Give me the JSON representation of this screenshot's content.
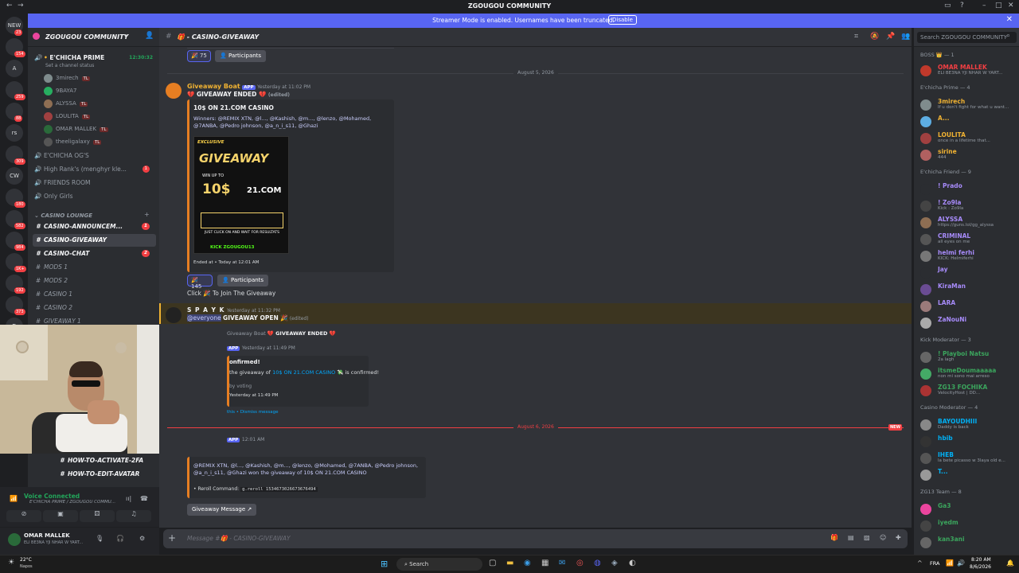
{
  "window": {
    "title": "ZGOUGOU COMMUNITY"
  },
  "streamer": {
    "text": "Streamer Mode is enabled. Usernames have been truncated.",
    "disable": "Disable"
  },
  "guilds": [
    {
      "label": "NEW",
      "badge": "23"
    },
    {
      "label": "",
      "badge": "154"
    },
    {
      "label": "A",
      "badge": ""
    },
    {
      "label": "",
      "badge": "259"
    },
    {
      "label": "",
      "badge": "88"
    },
    {
      "label": "rs",
      "badge": ""
    },
    {
      "label": "",
      "badge": "309"
    },
    {
      "label": "CW",
      "badge": ""
    },
    {
      "label": "",
      "badge": "180"
    },
    {
      "label": "",
      "badge": "582"
    },
    {
      "label": "",
      "badge": "984"
    },
    {
      "label": "",
      "badge": "1K+"
    },
    {
      "label": "",
      "badge": "192"
    },
    {
      "label": "",
      "badge": "373"
    },
    {
      "label": "D",
      "badge": ""
    }
  ],
  "server": {
    "name": "ZGOUGOU COMMUNITY"
  },
  "voice_channel": {
    "name": "E'CHICHA PRIME",
    "time": "12:30:32",
    "status": "Set a channel status",
    "users": [
      "3mirech",
      "9BAYA7",
      "ALYSSA",
      "LOULITA",
      "OMAR MALLEK",
      "theeligalaxy"
    ],
    "tag": "TL"
  },
  "channels": [
    {
      "icon": "🔊",
      "name": "E'CHICHA OG'S",
      "badge": ""
    },
    {
      "icon": "🔊",
      "name": "High Rank's (menghyr kle...",
      "badge": "1"
    },
    {
      "icon": "🔊",
      "name": "FRIENDS ROOM",
      "badge": ""
    },
    {
      "icon": "🔊",
      "name": "Only Girls",
      "badge": ""
    }
  ],
  "category": "CASINO LOUNGE",
  "casino_channels": [
    {
      "name": "CASINO-ANNOUNCEM...",
      "badge": "1",
      "sel": false,
      "bold": true
    },
    {
      "name": "CASINO-GIVEAWAY",
      "badge": "",
      "sel": true,
      "bold": true
    },
    {
      "name": "CASINO-CHAT",
      "badge": "2",
      "sel": false,
      "bold": true
    },
    {
      "name": "MODS 1",
      "badge": "",
      "sel": false,
      "bold": false
    },
    {
      "name": "MODS 2",
      "badge": "",
      "sel": false,
      "bold": false
    },
    {
      "name": "CASINO 1",
      "badge": "",
      "sel": false,
      "bold": false
    },
    {
      "name": "CASINO 2",
      "badge": "",
      "sel": false,
      "bold": false
    },
    {
      "name": "GIVEAWAY 1",
      "badge": "",
      "sel": false,
      "bold": false
    }
  ],
  "lower_channels": [
    "HOW-TO-ACTIVATE-2FA",
    "HOW-TO-EDIT-AVATAR"
  ],
  "voice_connected": {
    "label": "Voice Connected",
    "sub": "E'CHICHA PRIME / ZGOUGOU COMMU..."
  },
  "user": {
    "name": "OMAR MALLEK",
    "status": "ELI BE3NA YJI NHAR W YART..."
  },
  "channel_header": {
    "name": "CASINO-GIVEAWAY",
    "search": "Search ZGOUGOU COMMUNITY"
  },
  "messages": {
    "top_reaction": "75",
    "participants": "Participants",
    "date1": "August 5, 2026",
    "bot_name": "Giveaway Boat",
    "app": "APP",
    "bot_ts": "Yesterday at 11:02 PM",
    "ended": "GIVEAWAY ENDED",
    "edited": "(edited)",
    "prize": "10$ ON 21.COM CASINO",
    "winners": "Winners: @REMIX XTN, @l..., @Kashish, @m..., @lenzo, @Mohamed, @7ANBA, @Pedro johnson, @a_n_i_s11, @Ghazi",
    "poster": {
      "exclusive": "EXCLUSIVE",
      "giveaway": "GIVEAWAY",
      "win": "WIN UP TO",
      "amount": "10$",
      "site": "21.COM",
      "join": "JUST CLICK ON AND WAIT FOR RESULTATS",
      "kick": "KICK ZGOUGOU13"
    },
    "ended_at": "Ended at • Today at 12:01 AM",
    "reaction2": "145",
    "click": "Click",
    "click2": "To Join The Giveaway",
    "spayk": "S P A Y K",
    "spayk_ts": "Yesterday at 11:32 PM",
    "everyone": "@everyone",
    "gopen": "GIVEAWAY OPEN",
    "reply_name": "Giveaway Boat",
    "reply_text": "GIVEAWAY ENDED",
    "conf_title": "onfirmed!",
    "conf_text1": "the giveaway of",
    "conf_link": "10$ ON 21.COM CASINO",
    "conf_text2": "is confirmed!",
    "voting": "by voting",
    "conf_ts": "Yesterday at 11:49 PM",
    "dismiss": "this • Dismiss message",
    "date2": "August 6, 2026",
    "new": "NEW",
    "bot2_ts": "12:01 AM",
    "win_text": "@REMIX XTN, @l..., @Kashish, @m..., @lenzo, @Mohamed, @7ANBA, @Pedro johnson, @a_n_i_s11, @Ghazi won the giveaway of 10$ ON 21.COM CASINO",
    "reroll_label": "• Reroll Command:",
    "reroll_cmd": "g.reroll 1534673026673676494",
    "gmessage": "Giveaway Message"
  },
  "input": {
    "placeholder": "Message #🎁 - CASINO-GIVEAWAY"
  },
  "members": [
    {
      "head": "BOSS 👑 — 1",
      "y": 0
    },
    {
      "name": "OMAR MALLEK",
      "status": "ELI BE3NA YJI NHAR W YART...",
      "color": "#f23f43",
      "y": 1,
      "av": "#c0392b"
    },
    {
      "head": "E'chicha Prime — 4",
      "y": 2
    },
    {
      "name": "3mirech",
      "status": "If u don't fight for what u want...",
      "color": "#f0b232",
      "y": 3,
      "av": "#7f8c8d"
    },
    {
      "name": "A...",
      "status": "",
      "color": "#f0b232",
      "y": 4,
      "av": "#5dade2"
    },
    {
      "name": "LOULITA",
      "status": "once in a lifetime that...",
      "color": "#f0b232",
      "y": 5,
      "av": "#a04040"
    },
    {
      "name": "sirine",
      "status": "444",
      "color": "#f0b232",
      "y": 6,
      "av": "#b06060"
    },
    {
      "head": "E'chicha Friend — 9",
      "y": 7
    },
    {
      "name": "! Prado",
      "status": "",
      "color": "#a78bfa",
      "y": 8,
      "av": "#2b2d31"
    },
    {
      "name": "! Zo9la",
      "status": "Kick : Zo9la",
      "color": "#a78bfa",
      "y": 9,
      "av": "#444"
    },
    {
      "name": "ALYSSA",
      "status": "https://guns.lol/gg_alyssa",
      "color": "#a78bfa",
      "y": 10,
      "av": "#8e6e53"
    },
    {
      "name": "CRIMINAL",
      "status": "all eyes on me",
      "color": "#a78bfa",
      "y": 11,
      "av": "#555"
    },
    {
      "name": "helmi ferhi",
      "status": "KICK: Helmiferhi",
      "color": "#a78bfa",
      "y": 12,
      "av": "#777"
    },
    {
      "name": "Jay",
      "status": "",
      "color": "#a78bfa",
      "y": 13,
      "av": "#2b2d31"
    },
    {
      "name": "KiraMan",
      "status": "",
      "color": "#a78bfa",
      "y": 14,
      "av": "#6a4c93"
    },
    {
      "name": "LARA",
      "status": "",
      "color": "#a78bfa",
      "y": 15,
      "av": "#9b7a7a"
    },
    {
      "name": "ZaNouNi",
      "status": "",
      "color": "#a78bfa",
      "y": 16,
      "av": "#aaa"
    },
    {
      "head": "Kick Moderator — 3",
      "y": 17
    },
    {
      "name": "! Playboi Natsu",
      "status": "2a lagh",
      "color": "#3ba55d",
      "y": 18,
      "av": "#666"
    },
    {
      "name": "itsmeDoumaaaaa",
      "status": "non mi sono mai arreso",
      "color": "#3ba55d",
      "y": 19,
      "av": "#4a6"
    },
    {
      "name": "ZG13 FOCHIKA",
      "status": "VelocityHost | DD...",
      "color": "#3ba55d",
      "y": 20,
      "av": "#a33"
    },
    {
      "head": "Casino Moderator — 4",
      "y": 21
    },
    {
      "name": "BAYOUDHIII",
      "status": "Daddy is back",
      "color": "#00b0f4",
      "y": 22,
      "av": "#888"
    },
    {
      "name": "hbib",
      "status": "",
      "color": "#00b0f4",
      "y": 23,
      "av": "#333"
    },
    {
      "name": "IHEB",
      "status": "la bete picasso w 3laya old e...",
      "color": "#00b0f4",
      "y": 24,
      "av": "#555"
    },
    {
      "name": "T...",
      "status": "",
      "color": "#00b0f4",
      "y": 25,
      "av": "#999"
    },
    {
      "head": "ZG13 Team — 8",
      "y": 26
    },
    {
      "name": "Ga3",
      "status": "",
      "color": "#3ba55d",
      "y": 27,
      "av": "#eb459e"
    },
    {
      "name": "iyedm",
      "status": "",
      "color": "#3ba55d",
      "y": 28,
      "av": "#444"
    },
    {
      "name": "kan3ani",
      "status": "",
      "color": "#3ba55d",
      "y": 29,
      "av": "#666"
    }
  ],
  "taskbar": {
    "weather": "22°C",
    "weather_sub": "Napos",
    "search": "Search",
    "lang": "FRA",
    "time": "8:20 AM",
    "date": "8/6/2026"
  }
}
